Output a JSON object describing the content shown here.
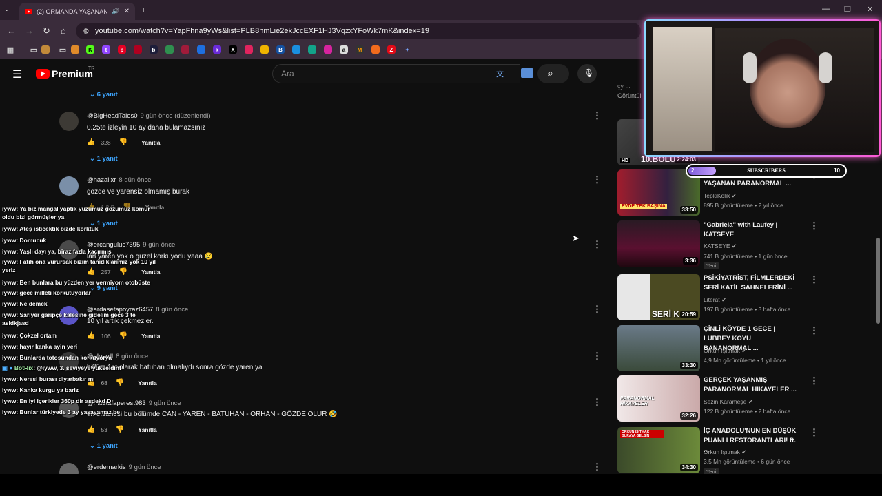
{
  "browser": {
    "tab_title": "(2) ORMANDA YAŞANAN PAR",
    "url": "youtube.com/watch?v=YapFhna9yWs&list=PLB8hmLie2ekJccEXF1HJ3VqzxYFoWk7mK&index=19",
    "new_tab": "+",
    "minimize": "—",
    "maximize": "❐",
    "close": "✕"
  },
  "youtube": {
    "logo_text": "Premium",
    "region": "TR",
    "search_placeholder": "Ara"
  },
  "comments": [
    {
      "replies_top": "6 yanıt"
    },
    {
      "author": "@BigHeadTales0",
      "time": "9 gün önce (düzenlendi)",
      "text": "0.25te izleyin 10 ay daha bulamazsınız",
      "likes": "328",
      "reply": "Yanıtla",
      "replies": "1 yanıt"
    },
    {
      "author": "@hazallxr",
      "time": "8 gün önce",
      "text": "gözde ve yarensiz olmamış burak",
      "likes": "1,2 B",
      "reply": "Yanıtla",
      "replies": "1 yanıt"
    },
    {
      "author": "@ercanguluc7395",
      "time": "9 gün önce",
      "text": "lan yaren yok o güzel korkuyodu yaaa 😢",
      "likes": "257",
      "reply": "Yanıtla",
      "replies": "9 yanıt"
    },
    {
      "author": "@ardasefapoyraz6457",
      "time": "8 gün önce",
      "text": "10 yıl artık çekmezler.",
      "likes": "106",
      "reply": "Yanıtla"
    },
    {
      "author": "@alperdl",
      "time": "8 gün önce",
      "text": "bölüm 1et olarak batuhan olmalıydı sonra gözde  yaren ya",
      "likes": "68",
      "reply": "Yanıtla"
    },
    {
      "author": "@mustafaperest983",
      "time": "9 gün önce",
      "text": "en efsanesi bu bölümde CAN - YAREN - BATUHAN - ORHAN - GÖZDE OLUR 🤣",
      "likes": "53",
      "reply": "Yanıtla",
      "replies": "1 yanıt"
    },
    {
      "author": "@erdemarkis",
      "time": "9 gün önce"
    }
  ],
  "chat": [
    {
      "user": "iyww",
      "msg": ": Ya biz mangal yaptık yüzümüz gözümüz kömür oldu bizi görmüşler ya"
    },
    {
      "user": "iyww",
      "msg": ": Ateş isticektik bizde korktuk"
    },
    {
      "user": "iyww",
      "msg": ": Domucuk"
    },
    {
      "user": "iyww",
      "msg": ": Yaşlı dayı ya, biraz fazla kaçırmış"
    },
    {
      "user": "iyww",
      "msg": ": Fatih ona vurursak bizim tanıdıklarımız yok 10 yıl yeriz"
    },
    {
      "user": "iyww",
      "msg": ": Ben bunlara bu yüzden yer vermiyom otobüste"
    },
    {
      "user": "iyww",
      "msg": ": gece milleti korkutuyorlar"
    },
    {
      "user": "iyww",
      "msg": ": Ne demek"
    },
    {
      "user": "iyww",
      "msg": ": Sarıyer garipçe kalesine gidelim gece 3 te asldkjasd"
    },
    {
      "user": "iyww",
      "msg": ": Çokzel ortam"
    },
    {
      "user": "iyww",
      "msg": ": hayır kanka ayin yeri"
    },
    {
      "user": "iyww",
      "msg": ": Bunlarda totosundan korkuyorya"
    },
    {
      "user": "BotRix",
      "msg": ": @iyww, 3. seviyeye yükseldin!"
    },
    {
      "user": "iyww",
      "msg": ": Neresi burası diyarbakır mı"
    },
    {
      "user": "iyww",
      "msg": ": Kanka kurgu ya bariz"
    },
    {
      "user": "iyww",
      "msg": ": En iyi içerikler 360p dir asdekd D"
    },
    {
      "user": "iyww",
      "msg": ": Bunlar türkiyede 3 ay yaşayamaz be"
    }
  ],
  "sidebar": {
    "top_text": "çy ...",
    "top_sub": "Görüntül",
    "videos": [
      {
        "title": "",
        "duration": "2:24:03",
        "badge": "HD",
        "thumb_text": "10.BÖLÜ"
      },
      {
        "title": "EVDE TEK BAŞINAYKEN YAŞANAN PARANORMAL ...",
        "channel": "TepkiKolik",
        "views": "895 B görüntüleme • 2 yıl önce",
        "duration": "33:50",
        "thumb_text": "EVDE TEK BAŞINA"
      },
      {
        "title": "\"Gabriela\" with Laufey | KATSEYE",
        "channel": "KATSEYE",
        "views": "741 B görüntüleme • 1 gün önce",
        "badge": "Yeni",
        "duration": "3:36"
      },
      {
        "title": "PSİKİYATRİST, FİLMLERDEKİ SERİ KATİL SAHNELERİNİ ...",
        "channel": "Literat",
        "views": "197 B görüntüleme • 3 hafta önce",
        "duration": "20:59",
        "thumb_text": "SERİ K"
      },
      {
        "title": "ÇİNLİ KÖYDE 1 GECE | LÜBBEY KÖYÜ BANANORMAL ...",
        "channel": "Orkun Işıtmak",
        "views": "4,9 Mn görüntüleme • 1 yıl önce",
        "duration": "33:30"
      },
      {
        "title": "GERÇEK YAŞANMIŞ PARANORMAL HİKAYELER ...",
        "channel": "Sezin Karameşe",
        "views": "122 B görüntüleme • 2 hafta önce",
        "duration": "32:26",
        "thumb_text": "PARANORMAL HİKAYELER"
      },
      {
        "title": "İÇ ANADOLU'NUN EN DÜŞÜK PUANLI RESTORANTLARI! ft. ...",
        "channel": "Orkun Işıtmak",
        "views": "3,5 Mn görüntüleme • 6 gün önce",
        "badge": "Yeni",
        "duration": "34:30",
        "thumb_text": "ORKUN IŞITMAK BURAYA GELSİN"
      }
    ]
  },
  "subs_widget": {
    "left": "2",
    "label": "SUBSCRIBERS",
    "right": "10"
  },
  "colors": {
    "accent": "#3ea6ff",
    "youtube_red": "#ff0000",
    "bg": "#0f0f0f"
  }
}
